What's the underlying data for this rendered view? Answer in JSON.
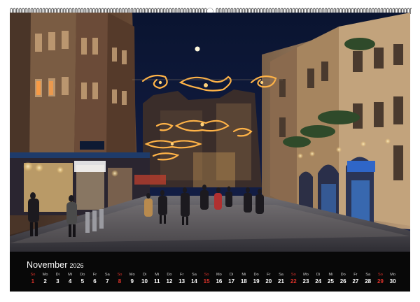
{
  "calendar": {
    "month": "November",
    "year": "2026",
    "days": [
      {
        "wd": "So",
        "n": "1",
        "sunday": true
      },
      {
        "wd": "Mo",
        "n": "2"
      },
      {
        "wd": "Di",
        "n": "3"
      },
      {
        "wd": "Mi",
        "n": "4"
      },
      {
        "wd": "Do",
        "n": "5"
      },
      {
        "wd": "Fr",
        "n": "6"
      },
      {
        "wd": "Sa",
        "n": "7"
      },
      {
        "wd": "So",
        "n": "8",
        "sunday": true
      },
      {
        "wd": "Mo",
        "n": "9"
      },
      {
        "wd": "Di",
        "n": "10"
      },
      {
        "wd": "Mi",
        "n": "11"
      },
      {
        "wd": "Do",
        "n": "12"
      },
      {
        "wd": "Fr",
        "n": "13"
      },
      {
        "wd": "Sa",
        "n": "14"
      },
      {
        "wd": "So",
        "n": "15",
        "sunday": true
      },
      {
        "wd": "Mo",
        "n": "16"
      },
      {
        "wd": "Di",
        "n": "17"
      },
      {
        "wd": "Mi",
        "n": "18"
      },
      {
        "wd": "Do",
        "n": "19"
      },
      {
        "wd": "Fr",
        "n": "20"
      },
      {
        "wd": "Sa",
        "n": "21"
      },
      {
        "wd": "So",
        "n": "22",
        "sunday": true
      },
      {
        "wd": "Mo",
        "n": "23"
      },
      {
        "wd": "Di",
        "n": "24"
      },
      {
        "wd": "Mi",
        "n": "25"
      },
      {
        "wd": "Do",
        "n": "26"
      },
      {
        "wd": "Fr",
        "n": "27"
      },
      {
        "wd": "Sa",
        "n": "28"
      },
      {
        "wd": "So",
        "n": "29",
        "sunday": true
      },
      {
        "wd": "Mo",
        "n": "30"
      }
    ]
  },
  "colors": {
    "calendar_bar": "#080808",
    "sunday_red": "#e0332b",
    "garland_gold": "#ffb347",
    "sky": "#0b1226"
  }
}
